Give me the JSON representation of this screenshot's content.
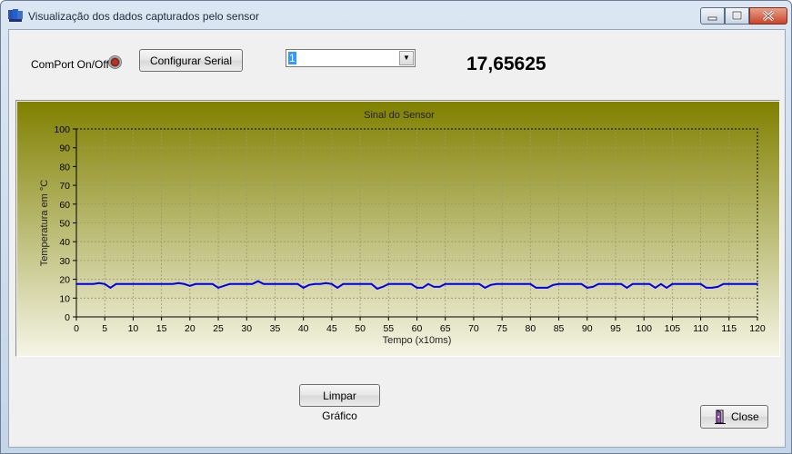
{
  "window": {
    "title": "Visualização dos dados capturados pelo sensor"
  },
  "controls": {
    "comport_label": "ComPort On/Off",
    "configure_button": "Configurar Serial",
    "port_select_value": "1",
    "current_reading": "17,65625",
    "clear_button": "Limpar Gráfico",
    "close_button": "Close"
  },
  "icons": {
    "app": "app-icon",
    "comport_status": "led-indicator-icon",
    "close": "door-exit-icon",
    "dropdown": "chevron-down-icon"
  },
  "colors": {
    "chart_top": "#808000",
    "chart_bottom": "#f5f5e6",
    "series": "#0000ee",
    "led": "#c03020"
  },
  "chart_data": {
    "type": "line",
    "title": "Sinal do Sensor",
    "xlabel": "Tempo (x10ms)",
    "ylabel": "Temperatura em °C",
    "xlim": [
      0,
      120
    ],
    "ylim": [
      0,
      100
    ],
    "xticks": [
      0,
      5,
      10,
      15,
      20,
      25,
      30,
      35,
      40,
      45,
      50,
      55,
      60,
      65,
      70,
      75,
      80,
      85,
      90,
      95,
      100,
      105,
      110,
      115,
      120
    ],
    "yticks": [
      0,
      10,
      20,
      30,
      40,
      50,
      60,
      70,
      80,
      90,
      100
    ],
    "grid": true,
    "series": [
      {
        "x": [
          0,
          1,
          2,
          3,
          4,
          5,
          6,
          7,
          8,
          9,
          10,
          11,
          12,
          13,
          14,
          15,
          16,
          17,
          18,
          19,
          20,
          21,
          22,
          23,
          24,
          25,
          26,
          27,
          28,
          29,
          30,
          31,
          32,
          33,
          34,
          35,
          36,
          37,
          38,
          39,
          40,
          41,
          42,
          43,
          44,
          45,
          46,
          47,
          48,
          49,
          50,
          51,
          52,
          53,
          54,
          55,
          56,
          57,
          58,
          59,
          60,
          61,
          62,
          63,
          64,
          65,
          66,
          67,
          68,
          69,
          70,
          71,
          72,
          73,
          74,
          75,
          76,
          77,
          78,
          79,
          80,
          81,
          82,
          83,
          84,
          85,
          86,
          87,
          88,
          89,
          90,
          91,
          92,
          93,
          94,
          95,
          96,
          97,
          98,
          99,
          100,
          101,
          102,
          103,
          104,
          105,
          106,
          107,
          108,
          109,
          110,
          111,
          112,
          113,
          114,
          115,
          116,
          117,
          118,
          119,
          120
        ],
        "values": [
          17.5,
          17.5,
          17.5,
          17.5,
          18,
          17.5,
          15.5,
          17.5,
          17.5,
          17.5,
          17.5,
          17.5,
          17.5,
          17.5,
          17.5,
          17.5,
          17.5,
          17.5,
          18,
          17.5,
          16.5,
          17.5,
          17.5,
          17.5,
          17.5,
          15.5,
          16.5,
          17.5,
          17.5,
          17.5,
          17.5,
          17.5,
          19,
          17.5,
          17.5,
          17.5,
          17.5,
          17.5,
          17.5,
          17.5,
          15.5,
          17,
          17.5,
          17.5,
          18,
          17.5,
          15.5,
          17.5,
          17.5,
          17.5,
          17.5,
          17.5,
          17.5,
          15,
          16,
          17.5,
          17.5,
          17.5,
          17.5,
          17.5,
          15.5,
          15.5,
          17.5,
          16,
          16,
          17.5,
          17.5,
          17.5,
          17.5,
          17.5,
          17.5,
          17.5,
          15.5,
          17,
          17.5,
          17.5,
          17.5,
          17.5,
          17.5,
          17.5,
          17.5,
          15.5,
          15.5,
          15.5,
          17,
          17.5,
          17.5,
          17.5,
          17.5,
          17.5,
          15.5,
          16,
          17.5,
          17.5,
          17.5,
          17.5,
          17.5,
          15.5,
          17.5,
          17.5,
          17.5,
          17.5,
          15.5,
          17.5,
          15.5,
          17.5,
          17.5,
          17.5,
          17.5,
          17.5,
          17.5,
          15.5,
          15.5,
          16,
          17.5,
          17.5,
          17.5,
          17.5,
          17.5,
          17.5,
          17.5
        ]
      }
    ]
  }
}
